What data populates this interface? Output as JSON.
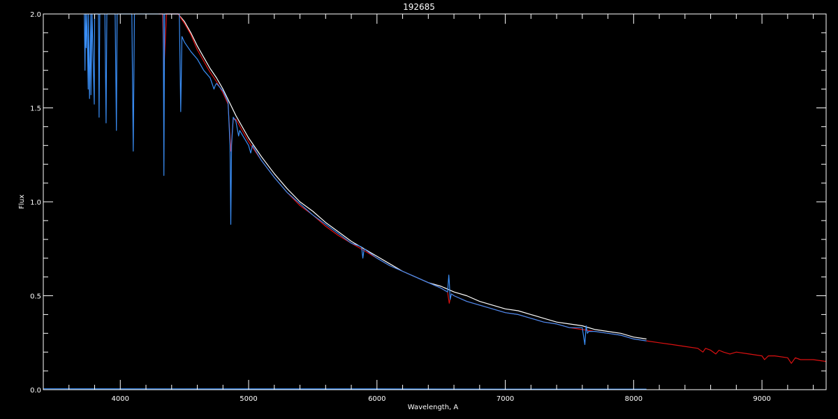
{
  "chart_data": {
    "type": "line",
    "title": "192685",
    "xlabel": "Wavelength, A",
    "ylabel": "Flux",
    "xlim": [
      3400,
      9500
    ],
    "ylim": [
      0.0,
      2.0
    ],
    "x_ticks": [
      4000,
      5000,
      6000,
      7000,
      8000,
      9000
    ],
    "x_tick_labels": [
      "4000",
      "5000",
      "6000",
      "7000",
      "8000",
      "9000"
    ],
    "y_ticks": [
      0.0,
      0.5,
      1.0,
      1.5,
      2.0
    ],
    "y_tick_labels": [
      "0.0",
      "0.5",
      "1.0",
      "1.5",
      "2.0"
    ],
    "grid": false,
    "background": "#000000",
    "series": [
      {
        "color": "#ffffff",
        "x": [
          4350,
          4400,
          4450,
          4500,
          4550,
          4600,
          4650,
          4700,
          4750,
          4800,
          4850,
          4900,
          5000,
          5100,
          5200,
          5300,
          5400,
          5500,
          5600,
          5700,
          5800,
          5900,
          6000,
          6100,
          6200,
          6300,
          6400,
          6500,
          6600,
          6700,
          6800,
          6900,
          7000,
          7100,
          7200,
          7300,
          7400,
          7500,
          7600,
          7700,
          7800,
          7900,
          8000,
          8100
        ],
        "y": [
          2.0,
          2.0,
          2.0,
          1.96,
          1.9,
          1.83,
          1.77,
          1.71,
          1.66,
          1.6,
          1.53,
          1.46,
          1.34,
          1.24,
          1.15,
          1.07,
          1.0,
          0.95,
          0.89,
          0.84,
          0.79,
          0.75,
          0.71,
          0.67,
          0.63,
          0.6,
          0.57,
          0.55,
          0.52,
          0.5,
          0.47,
          0.45,
          0.43,
          0.42,
          0.4,
          0.38,
          0.36,
          0.35,
          0.34,
          0.32,
          0.31,
          0.3,
          0.28,
          0.27
        ]
      },
      {
        "color": "#dd1111",
        "x": [
          4300,
          4330,
          4340,
          4360,
          4400,
          4450,
          4500,
          4550,
          4600,
          4650,
          4700,
          4750,
          4800,
          4840,
          4861,
          4880,
          4900,
          5000,
          5100,
          5200,
          5300,
          5400,
          5500,
          5600,
          5700,
          5800,
          5900,
          6000,
          6100,
          6200,
          6300,
          6400,
          6500,
          6550,
          6563,
          6580,
          6600,
          6700,
          6800,
          6900,
          7000,
          7100,
          7200,
          7300,
          7400,
          7500,
          7600,
          7700,
          7800,
          7900,
          8000,
          8100,
          8200,
          8300,
          8400,
          8500,
          8540,
          8560,
          8600,
          8640,
          8665,
          8700,
          8750,
          8800,
          8900,
          9000,
          9020,
          9050,
          9100,
          9200,
          9229,
          9260,
          9300,
          9400,
          9500
        ],
        "y": [
          2.0,
          2.0,
          1.7,
          2.0,
          2.0,
          2.0,
          1.95,
          1.89,
          1.81,
          1.75,
          1.69,
          1.64,
          1.58,
          1.52,
          1.27,
          1.44,
          1.44,
          1.32,
          1.22,
          1.13,
          1.05,
          0.98,
          0.93,
          0.87,
          0.82,
          0.78,
          0.74,
          0.7,
          0.66,
          0.63,
          0.6,
          0.57,
          0.54,
          0.52,
          0.46,
          0.51,
          0.5,
          0.47,
          0.45,
          0.43,
          0.41,
          0.4,
          0.38,
          0.36,
          0.35,
          0.33,
          0.32,
          0.31,
          0.3,
          0.29,
          0.27,
          0.26,
          0.25,
          0.24,
          0.23,
          0.22,
          0.2,
          0.22,
          0.21,
          0.19,
          0.21,
          0.2,
          0.19,
          0.2,
          0.19,
          0.18,
          0.16,
          0.18,
          0.18,
          0.17,
          0.14,
          0.17,
          0.16,
          0.16,
          0.15
        ]
      },
      {
        "color": "#3a8ef6",
        "x": [
          3720,
          3725,
          3730,
          3734,
          3740,
          3750,
          3752,
          3760,
          3770,
          3771,
          3780,
          3797,
          3800,
          3830,
          3835,
          3840,
          3880,
          3889,
          3895,
          3960,
          3970,
          3975,
          4090,
          4101,
          4110,
          4300,
          4335,
          4340,
          4345,
          4460,
          4471,
          4480,
          4500,
          4550,
          4600,
          4650,
          4700,
          4730,
          4740,
          4750,
          4800,
          4840,
          4855,
          4861,
          4867,
          4880,
          4900,
          4922,
          4930,
          5000,
          5016,
          5030,
          5100,
          5200,
          5300,
          5400,
          5500,
          5600,
          5700,
          5800,
          5880,
          5890,
          5900,
          6000,
          6100,
          6200,
          6300,
          6400,
          6500,
          6550,
          6560,
          6565,
          6570,
          6580,
          6600,
          6700,
          6800,
          6900,
          7000,
          7100,
          7200,
          7300,
          7400,
          7500,
          7600,
          7620,
          7630,
          7640,
          7650,
          7700,
          7800,
          7900,
          8000,
          8100
        ],
        "y": [
          2.0,
          1.7,
          2.0,
          1.82,
          2.0,
          1.6,
          2.0,
          1.55,
          2.0,
          1.57,
          2.0,
          1.52,
          2.0,
          2.0,
          1.45,
          2.0,
          2.0,
          1.42,
          2.0,
          2.0,
          1.38,
          2.0,
          2.0,
          1.27,
          2.0,
          2.0,
          2.0,
          1.14,
          2.0,
          2.0,
          1.48,
          1.88,
          1.85,
          1.8,
          1.76,
          1.7,
          1.66,
          1.6,
          1.62,
          1.63,
          1.59,
          1.53,
          1.3,
          0.88,
          1.3,
          1.45,
          1.43,
          1.35,
          1.38,
          1.3,
          1.26,
          1.3,
          1.22,
          1.13,
          1.05,
          0.99,
          0.93,
          0.88,
          0.83,
          0.78,
          0.76,
          0.7,
          0.75,
          0.7,
          0.66,
          0.63,
          0.6,
          0.57,
          0.54,
          0.52,
          0.61,
          0.56,
          0.48,
          0.51,
          0.5,
          0.47,
          0.45,
          0.43,
          0.41,
          0.4,
          0.38,
          0.36,
          0.35,
          0.33,
          0.33,
          0.24,
          0.34,
          0.3,
          0.31,
          0.31,
          0.3,
          0.29,
          0.27,
          0.26
        ]
      },
      {
        "color": "#3a8ef6",
        "x": [
          3400,
          5000,
          6000,
          7000,
          8100
        ],
        "y": [
          0.005,
          0.004,
          0.004,
          0.003,
          0.003
        ]
      }
    ]
  }
}
